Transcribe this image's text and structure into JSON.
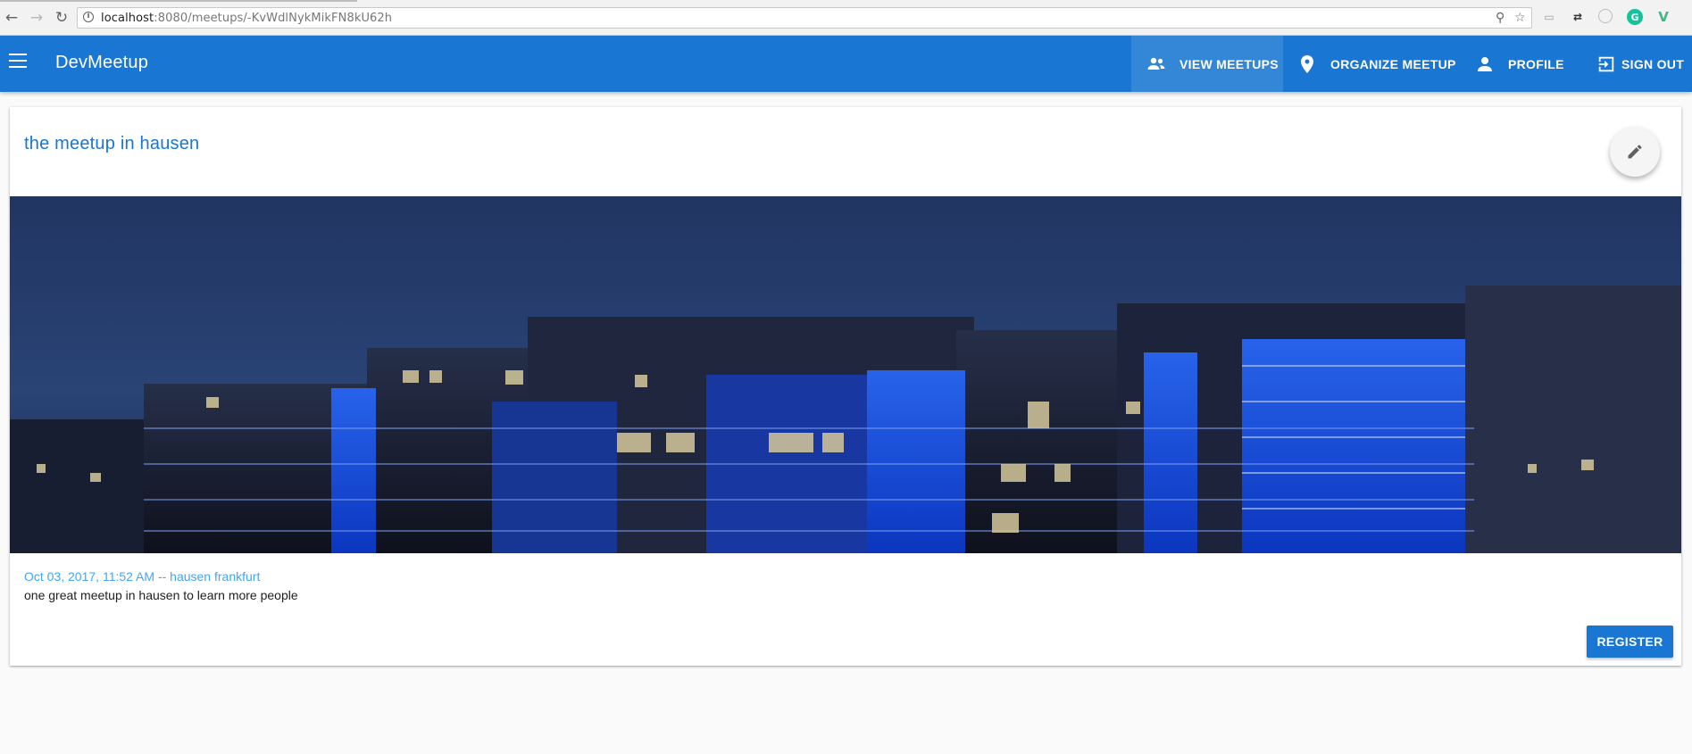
{
  "browser": {
    "url_host": "localhost",
    "url_path": ":8080/meetups/-KvWdlNykMikFN8kU62h"
  },
  "app": {
    "brand": "DevMeetup",
    "nav": [
      {
        "label": "VIEW MEETUPS",
        "icon": "supervisor-account-icon",
        "active": true
      },
      {
        "label": "ORGANIZE MEETUP",
        "icon": "location-pin-icon",
        "active": false
      },
      {
        "label": "PROFILE",
        "icon": "person-icon",
        "active": false
      },
      {
        "label": "SIGN OUT",
        "icon": "exit-to-app-icon",
        "active": false
      }
    ],
    "accent_color": "#1976d2"
  },
  "meetup": {
    "title": "the meetup in hausen",
    "meta": "Oct 03, 2017, 11:52 AM -- hausen frankfurt",
    "description": "one great meetup in hausen to learn more people",
    "register_label": "REGISTER",
    "image_icon": "night-office-buildings-photo"
  }
}
